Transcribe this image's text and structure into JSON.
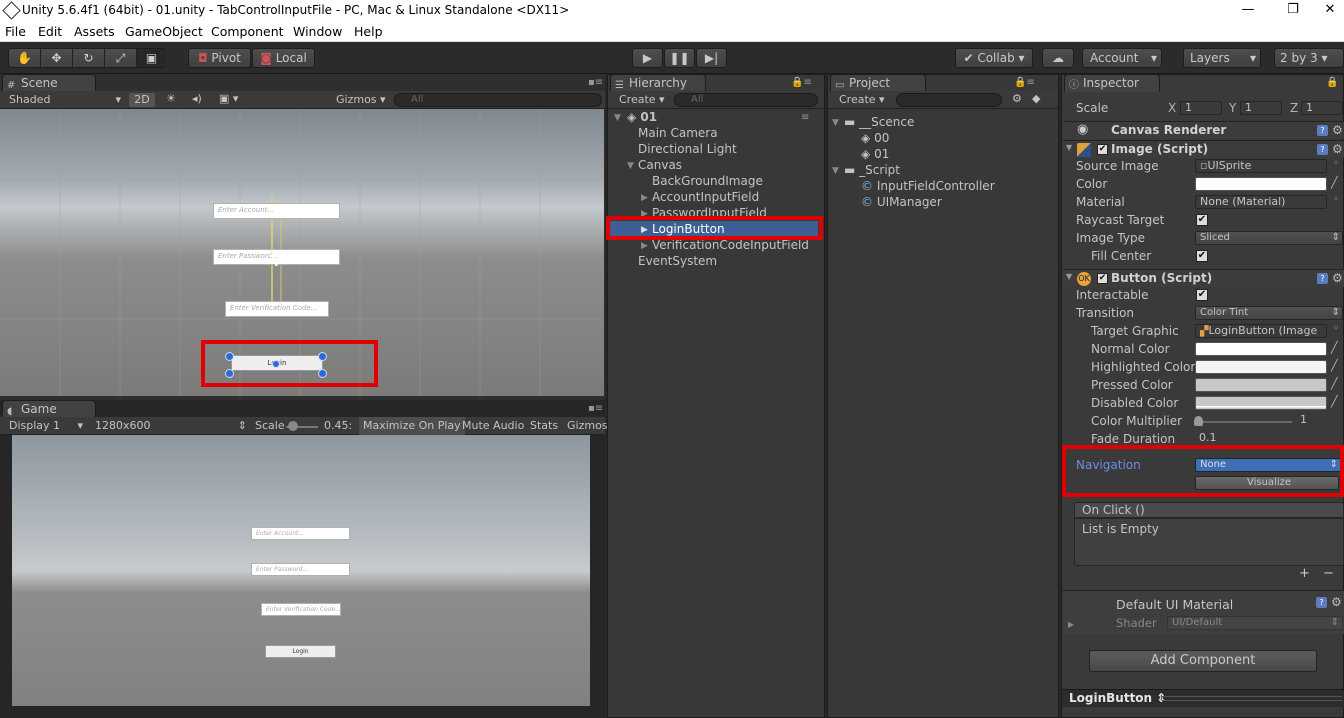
{
  "window": {
    "title": "Unity 5.6.4f1 (64bit) - 01.unity - TabControlInputFile - PC, Mac & Linux Standalone <DX11>",
    "minimize": "—",
    "restore": "❐",
    "close": "✕"
  },
  "menu": [
    "File",
    "Edit",
    "Assets",
    "GameObject",
    "Component",
    "Window",
    "Help"
  ],
  "toolbar": {
    "pivot": "Pivot",
    "local": "Local",
    "collab": "Collab",
    "account": "Account",
    "layers": "Layers",
    "layout": "2 by 3"
  },
  "scene": {
    "tab": "Scene",
    "shaded": "Shaded",
    "mode2d": "2D",
    "gizmos": "Gizmos",
    "search_placeholder": "All",
    "account_placeholder": "Enter Account...",
    "password_placeholder": "Enter Password...",
    "verification_placeholder": "Enter Verification Code...",
    "login": "Login"
  },
  "game": {
    "tab": "Game",
    "display": "Display 1",
    "resolution": "1280x600",
    "scale_label": "Scale",
    "scale_value": "0.45",
    "maximize": "Maximize On Play",
    "mute": "Mute Audio",
    "stats": "Stats",
    "gizmos": "Gizmos",
    "account_placeholder": "Enter Account...",
    "password_placeholder": "Enter Password...",
    "verification_placeholder": "Enter Verification Code...",
    "login": "Login"
  },
  "hierarchy": {
    "tab": "Hierarchy",
    "create": "Create",
    "search_placeholder": "All",
    "scene_name": "01",
    "items": [
      "Main Camera",
      "Directional Light",
      "Canvas",
      "BackGroundImage",
      "AccountInputField",
      "PasswordInputField",
      "LoginButton",
      "VerificationCodeInputField",
      "EventSystem"
    ]
  },
  "project": {
    "tab": "Project",
    "create": "Create",
    "items": [
      "__Scence",
      "00",
      "01",
      "_Script",
      "InputFieldController",
      "UIManager"
    ]
  },
  "inspector": {
    "tab": "Inspector",
    "scale_label": "Scale",
    "scale_x": "1",
    "scale_y": "1",
    "scale_z": "1",
    "axis_x": "X",
    "axis_y": "Y",
    "axis_z": "Z",
    "canvas_renderer": "Canvas Renderer",
    "image_script": "Image (Script)",
    "source_image_label": "Source Image",
    "source_image": "UISprite",
    "color_label": "Color",
    "material_label": "Material",
    "material": "None (Material)",
    "raycast_label": "Raycast Target",
    "image_type_label": "Image Type",
    "image_type": "Sliced",
    "fill_center_label": "Fill Center",
    "button_script": "Button (Script)",
    "interactable_label": "Interactable",
    "transition_label": "Transition",
    "transition": "Color Tint",
    "target_graphic_label": "Target Graphic",
    "target_graphic": "LoginButton (Image",
    "normal_color_label": "Normal Color",
    "highlighted_color_label": "Highlighted Color",
    "pressed_color_label": "Pressed Color",
    "disabled_color_label": "Disabled Color",
    "color_multiplier_label": "Color Multiplier",
    "color_multiplier": "1",
    "fade_duration_label": "Fade Duration",
    "fade_duration": "0.1",
    "navigation_label": "Navigation",
    "navigation": "None",
    "visualize": "Visualize",
    "onclick_title": "On Click ()",
    "onclick_empty": "List is Empty",
    "plus": "+",
    "minus": "−",
    "material_name": "Default UI Material",
    "shader_label": "Shader",
    "shader": "UI/Default",
    "add_component": "Add Component",
    "footer": "LoginButton"
  },
  "colors": {
    "highlight_red": "#e00000",
    "nav_blue": "#6b8ee6",
    "accent": "#3d6fb6"
  }
}
